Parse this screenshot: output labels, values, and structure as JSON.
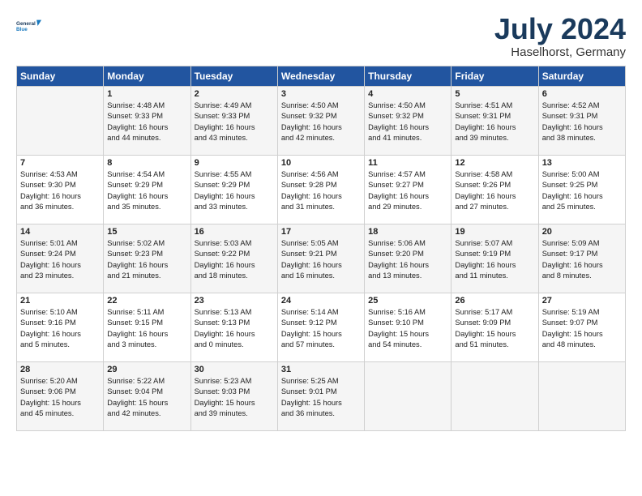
{
  "header": {
    "logo_line1": "General",
    "logo_line2": "Blue",
    "month": "July 2024",
    "location": "Haselhorst, Germany"
  },
  "weekdays": [
    "Sunday",
    "Monday",
    "Tuesday",
    "Wednesday",
    "Thursday",
    "Friday",
    "Saturday"
  ],
  "weeks": [
    [
      {
        "day": "",
        "info": ""
      },
      {
        "day": "1",
        "info": "Sunrise: 4:48 AM\nSunset: 9:33 PM\nDaylight: 16 hours\nand 44 minutes."
      },
      {
        "day": "2",
        "info": "Sunrise: 4:49 AM\nSunset: 9:33 PM\nDaylight: 16 hours\nand 43 minutes."
      },
      {
        "day": "3",
        "info": "Sunrise: 4:50 AM\nSunset: 9:32 PM\nDaylight: 16 hours\nand 42 minutes."
      },
      {
        "day": "4",
        "info": "Sunrise: 4:50 AM\nSunset: 9:32 PM\nDaylight: 16 hours\nand 41 minutes."
      },
      {
        "day": "5",
        "info": "Sunrise: 4:51 AM\nSunset: 9:31 PM\nDaylight: 16 hours\nand 39 minutes."
      },
      {
        "day": "6",
        "info": "Sunrise: 4:52 AM\nSunset: 9:31 PM\nDaylight: 16 hours\nand 38 minutes."
      }
    ],
    [
      {
        "day": "7",
        "info": "Sunrise: 4:53 AM\nSunset: 9:30 PM\nDaylight: 16 hours\nand 36 minutes."
      },
      {
        "day": "8",
        "info": "Sunrise: 4:54 AM\nSunset: 9:29 PM\nDaylight: 16 hours\nand 35 minutes."
      },
      {
        "day": "9",
        "info": "Sunrise: 4:55 AM\nSunset: 9:29 PM\nDaylight: 16 hours\nand 33 minutes."
      },
      {
        "day": "10",
        "info": "Sunrise: 4:56 AM\nSunset: 9:28 PM\nDaylight: 16 hours\nand 31 minutes."
      },
      {
        "day": "11",
        "info": "Sunrise: 4:57 AM\nSunset: 9:27 PM\nDaylight: 16 hours\nand 29 minutes."
      },
      {
        "day": "12",
        "info": "Sunrise: 4:58 AM\nSunset: 9:26 PM\nDaylight: 16 hours\nand 27 minutes."
      },
      {
        "day": "13",
        "info": "Sunrise: 5:00 AM\nSunset: 9:25 PM\nDaylight: 16 hours\nand 25 minutes."
      }
    ],
    [
      {
        "day": "14",
        "info": "Sunrise: 5:01 AM\nSunset: 9:24 PM\nDaylight: 16 hours\nand 23 minutes."
      },
      {
        "day": "15",
        "info": "Sunrise: 5:02 AM\nSunset: 9:23 PM\nDaylight: 16 hours\nand 21 minutes."
      },
      {
        "day": "16",
        "info": "Sunrise: 5:03 AM\nSunset: 9:22 PM\nDaylight: 16 hours\nand 18 minutes."
      },
      {
        "day": "17",
        "info": "Sunrise: 5:05 AM\nSunset: 9:21 PM\nDaylight: 16 hours\nand 16 minutes."
      },
      {
        "day": "18",
        "info": "Sunrise: 5:06 AM\nSunset: 9:20 PM\nDaylight: 16 hours\nand 13 minutes."
      },
      {
        "day": "19",
        "info": "Sunrise: 5:07 AM\nSunset: 9:19 PM\nDaylight: 16 hours\nand 11 minutes."
      },
      {
        "day": "20",
        "info": "Sunrise: 5:09 AM\nSunset: 9:17 PM\nDaylight: 16 hours\nand 8 minutes."
      }
    ],
    [
      {
        "day": "21",
        "info": "Sunrise: 5:10 AM\nSunset: 9:16 PM\nDaylight: 16 hours\nand 5 minutes."
      },
      {
        "day": "22",
        "info": "Sunrise: 5:11 AM\nSunset: 9:15 PM\nDaylight: 16 hours\nand 3 minutes."
      },
      {
        "day": "23",
        "info": "Sunrise: 5:13 AM\nSunset: 9:13 PM\nDaylight: 16 hours\nand 0 minutes."
      },
      {
        "day": "24",
        "info": "Sunrise: 5:14 AM\nSunset: 9:12 PM\nDaylight: 15 hours\nand 57 minutes."
      },
      {
        "day": "25",
        "info": "Sunrise: 5:16 AM\nSunset: 9:10 PM\nDaylight: 15 hours\nand 54 minutes."
      },
      {
        "day": "26",
        "info": "Sunrise: 5:17 AM\nSunset: 9:09 PM\nDaylight: 15 hours\nand 51 minutes."
      },
      {
        "day": "27",
        "info": "Sunrise: 5:19 AM\nSunset: 9:07 PM\nDaylight: 15 hours\nand 48 minutes."
      }
    ],
    [
      {
        "day": "28",
        "info": "Sunrise: 5:20 AM\nSunset: 9:06 PM\nDaylight: 15 hours\nand 45 minutes."
      },
      {
        "day": "29",
        "info": "Sunrise: 5:22 AM\nSunset: 9:04 PM\nDaylight: 15 hours\nand 42 minutes."
      },
      {
        "day": "30",
        "info": "Sunrise: 5:23 AM\nSunset: 9:03 PM\nDaylight: 15 hours\nand 39 minutes."
      },
      {
        "day": "31",
        "info": "Sunrise: 5:25 AM\nSunset: 9:01 PM\nDaylight: 15 hours\nand 36 minutes."
      },
      {
        "day": "",
        "info": ""
      },
      {
        "day": "",
        "info": ""
      },
      {
        "day": "",
        "info": ""
      }
    ]
  ]
}
